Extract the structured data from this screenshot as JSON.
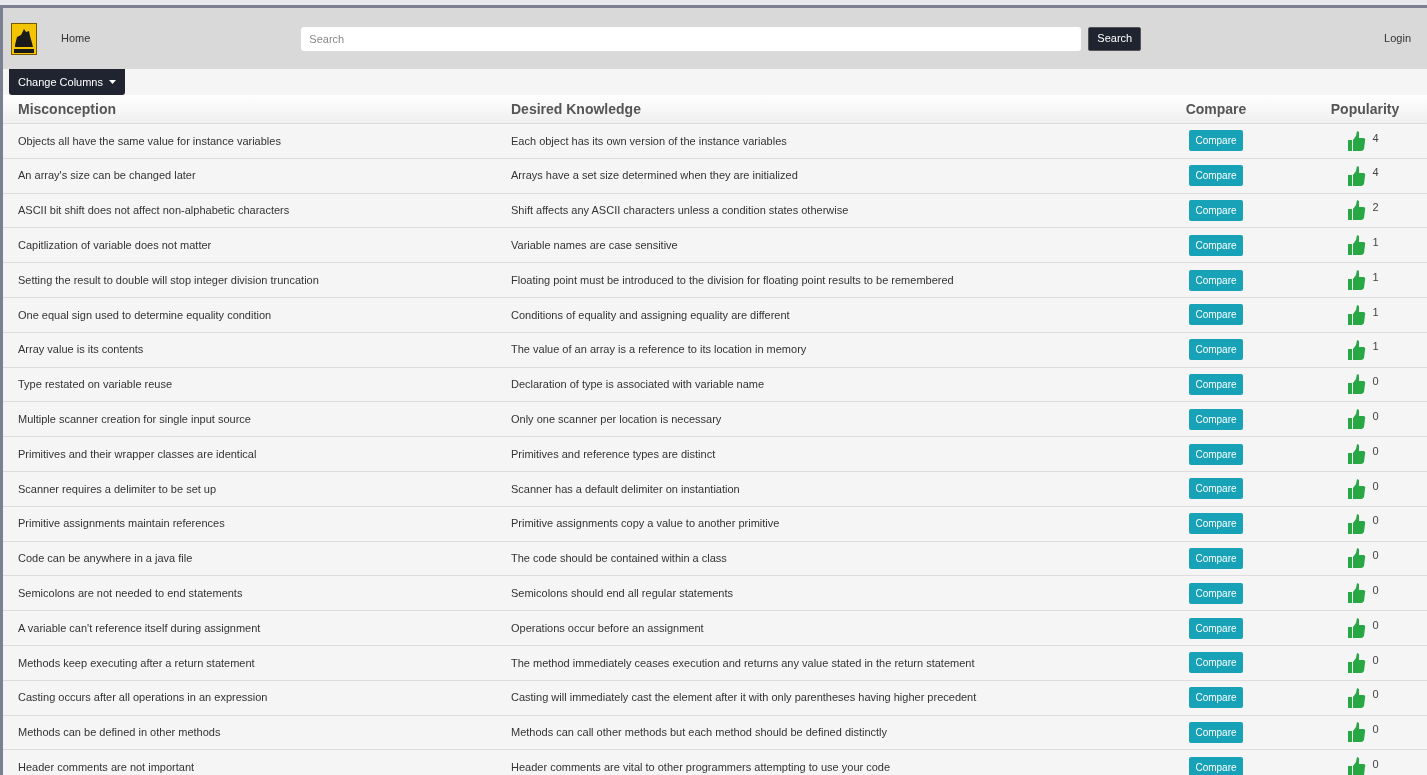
{
  "nav": {
    "home": "Home",
    "search_placeholder": "Search",
    "search_button": "Search",
    "login": "Login"
  },
  "change_columns": "Change Columns",
  "table": {
    "columns": [
      "Misconception",
      "Desired Knowledge",
      "Compare",
      "Popularity"
    ],
    "rows": [
      {
        "misconception": "Objects all have the same value for instance variables",
        "desired": "Each object has its own version of the instance variables",
        "compare": "Compare",
        "popularity": "4"
      },
      {
        "misconception": "An array's size can be changed later",
        "desired": "Arrays have a set size determined when they are initialized",
        "compare": "Compare",
        "popularity": "4"
      },
      {
        "misconception": "ASCII bit shift does not affect non-alphabetic characters",
        "desired": "Shift affects any ASCII characters unless a condition states otherwise",
        "compare": "Compare",
        "popularity": "2"
      },
      {
        "misconception": "Capitlization of variable does not matter",
        "desired": "Variable names are case sensitive",
        "compare": "Compare",
        "popularity": "1"
      },
      {
        "misconception": "Setting the result to double will stop integer division truncation",
        "desired": "Floating point must be introduced to the division for floating point results to be remembered",
        "compare": "Compare",
        "popularity": "1"
      },
      {
        "misconception": "One equal sign used to determine equality condition",
        "desired": "Conditions of equality and assigning equality are different",
        "compare": "Compare",
        "popularity": "1"
      },
      {
        "misconception": "Array value is its contents",
        "desired": "The value of an array is a reference to its location in memory",
        "compare": "Compare",
        "popularity": "1"
      },
      {
        "misconception": "Type restated on variable reuse",
        "desired": "Declaration of type is associated with variable name",
        "compare": "Compare",
        "popularity": "0"
      },
      {
        "misconception": "Multiple scanner creation for single input source",
        "desired": "Only one scanner per location is necessary",
        "compare": "Compare",
        "popularity": "0"
      },
      {
        "misconception": "Primitives and their wrapper classes are identical",
        "desired": "Primitives and reference types are distinct",
        "compare": "Compare",
        "popularity": "0"
      },
      {
        "misconception": "Scanner requires a delimiter to be set up",
        "desired": "Scanner has a default delimiter on instantiation",
        "compare": "Compare",
        "popularity": "0"
      },
      {
        "misconception": "Primitive assignments maintain references",
        "desired": "Primitive assignments copy a value to another primitive",
        "compare": "Compare",
        "popularity": "0"
      },
      {
        "misconception": "Code can be anywhere in a java file",
        "desired": "The code should be contained within a class",
        "compare": "Compare",
        "popularity": "0"
      },
      {
        "misconception": "Semicolons are not needed to end statements",
        "desired": "Semicolons should end all regular statements",
        "compare": "Compare",
        "popularity": "0"
      },
      {
        "misconception": "A variable can't reference itself during assignment",
        "desired": "Operations occur before an assignment",
        "compare": "Compare",
        "popularity": "0"
      },
      {
        "misconception": "Methods keep executing after a return statement",
        "desired": "The method immediately ceases execution and returns any value stated in the return statement",
        "compare": "Compare",
        "popularity": "0"
      },
      {
        "misconception": "Casting occurs after all operations in an expression",
        "desired": "Casting will immediately cast the element after it with only parentheses having higher precedent",
        "compare": "Compare",
        "popularity": "0"
      },
      {
        "misconception": "Methods can be defined in other methods",
        "desired": "Methods can call other methods but each method should be defined distinctly",
        "compare": "Compare",
        "popularity": "0"
      },
      {
        "misconception": "Header comments are not important",
        "desired": "Header comments are vital to other programmers attempting to use your code",
        "compare": "Compare",
        "popularity": "0"
      }
    ]
  }
}
